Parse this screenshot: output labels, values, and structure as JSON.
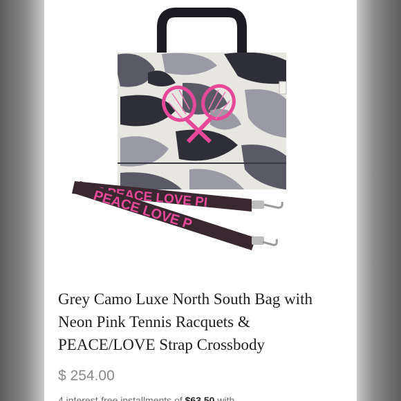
{
  "product": {
    "title": "Grey Camo Luxe North South Bag with Neon Pink Tennis Racquets & PEACE/LOVE Strap Crossbody",
    "price": "$ 254.00",
    "shipping_text": "4 interest-free installments of",
    "installment_amount": "$63.50",
    "shipping_suffix": "with"
  },
  "image": {
    "strap_text": "PEACE LOVE PEACE LOVE P",
    "strap_text_lower": "PEACE LOVE P",
    "strap_text_upper": "VE PEACE LOVE PI",
    "accent_color": "#e8489a",
    "camo_colors": [
      "#5a5a66",
      "#9a9aa4",
      "#e8e6e0",
      "#2e2e36"
    ]
  }
}
